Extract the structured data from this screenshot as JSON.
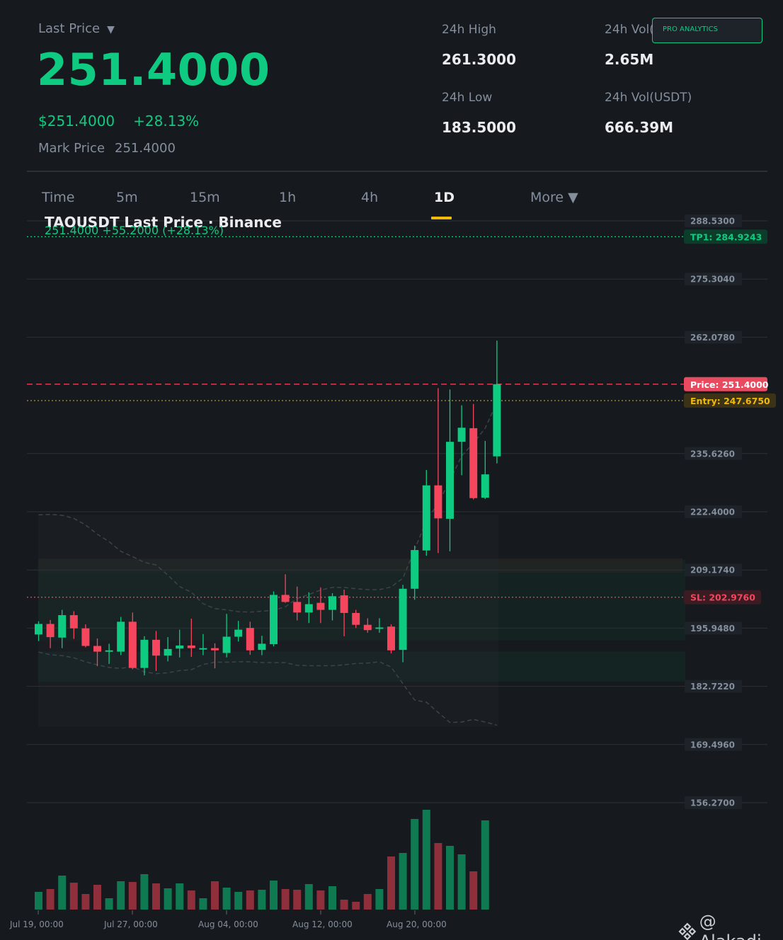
{
  "header": {
    "last_price_label": "Last Price",
    "last_price_caret": "▼",
    "last_price": "251.4000",
    "usd_price": "$251.4000",
    "change_pct": "+28.13%",
    "mark_price_label": "Mark Price",
    "mark_price": "251.4000",
    "stats": [
      {
        "label": "24h High",
        "value": "261.3000"
      },
      {
        "label": "24h Vol(",
        "value": "2.65M"
      },
      {
        "label": "24h Low",
        "value": "183.5000"
      },
      {
        "label": "24h Vol(USDT)",
        "value": "666.39M"
      }
    ],
    "pro_button": "PRO ANALYTICS"
  },
  "tabs": [
    {
      "label": "Time",
      "active": false
    },
    {
      "label": "5m",
      "active": false
    },
    {
      "label": "15m",
      "active": false
    },
    {
      "label": "1h",
      "active": false
    },
    {
      "label": "4h",
      "active": false
    },
    {
      "label": "1D",
      "active": true
    },
    {
      "label": "More ▼",
      "active": false
    }
  ],
  "chart": {
    "title": "TAOUSDT Last Price · Binance",
    "subtitle": "251.4000  +55.2000 (+28.13%)",
    "brand": "@ Alakadi",
    "colors": {
      "up": "#0ecb81",
      "down": "#f6465d",
      "entry": "#f0b90b",
      "bg": "#161a1e",
      "grid": "#2b3139"
    }
  },
  "chart_data": {
    "type": "candlestick",
    "title": "TAOUSDT Last Price · Binance",
    "y_ticks": [
      "288.5300",
      "275.3040",
      "262.0780",
      "235.6260",
      "222.4000",
      "209.1740",
      "195.9480",
      "182.7220",
      "169.4960",
      "156.2700"
    ],
    "ylim": [
      156.27,
      288.53
    ],
    "x_ticks": [
      "Jul 19, 00:00",
      "Jul 27, 00:00",
      "Aug 04, 00:00",
      "Aug 12, 00:00",
      "Aug 20, 00:00"
    ],
    "levels": [
      {
        "label": "TP1: 284.9243",
        "value": 284.9243,
        "kind": "tp"
      },
      {
        "label": "Price: 251.4000",
        "value": 251.4,
        "kind": "price"
      },
      {
        "label": "Entry: 247.6750",
        "value": 247.675,
        "kind": "entry"
      },
      {
        "label": "SL: 202.9760",
        "value": 202.976,
        "kind": "sl"
      }
    ],
    "candles": [
      {
        "o": 194.5,
        "h": 197.5,
        "l": 193.0,
        "c": 196.9
      },
      {
        "o": 196.9,
        "h": 197.8,
        "l": 191.4,
        "c": 193.9
      },
      {
        "o": 193.8,
        "h": 200.1,
        "l": 191.4,
        "c": 198.9
      },
      {
        "o": 198.9,
        "h": 199.8,
        "l": 193.5,
        "c": 195.9
      },
      {
        "o": 195.9,
        "h": 196.8,
        "l": 191.6,
        "c": 191.9
      },
      {
        "o": 191.9,
        "h": 193.6,
        "l": 187.3,
        "c": 190.6
      },
      {
        "o": 190.6,
        "h": 192.4,
        "l": 187.8,
        "c": 190.9
      },
      {
        "o": 190.6,
        "h": 198.5,
        "l": 189.8,
        "c": 197.4
      },
      {
        "o": 197.4,
        "h": 199.5,
        "l": 186.6,
        "c": 186.9
      },
      {
        "o": 186.9,
        "h": 194.1,
        "l": 185.2,
        "c": 193.3
      },
      {
        "o": 193.3,
        "h": 195.3,
        "l": 186.2,
        "c": 189.7
      },
      {
        "o": 189.7,
        "h": 193.9,
        "l": 188.4,
        "c": 191.2
      },
      {
        "o": 191.3,
        "h": 195.6,
        "l": 189.3,
        "c": 192.0
      },
      {
        "o": 192.0,
        "h": 198.1,
        "l": 189.4,
        "c": 191.4
      },
      {
        "o": 191.3,
        "h": 194.6,
        "l": 189.8,
        "c": 191.4
      },
      {
        "o": 191.4,
        "h": 192.5,
        "l": 186.8,
        "c": 190.9
      },
      {
        "o": 190.3,
        "h": 199.2,
        "l": 189.3,
        "c": 194.0
      },
      {
        "o": 194.0,
        "h": 197.6,
        "l": 192.9,
        "c": 195.6
      },
      {
        "o": 196.0,
        "h": 197.4,
        "l": 189.9,
        "c": 190.9
      },
      {
        "o": 191.0,
        "h": 194.2,
        "l": 189.8,
        "c": 192.4
      },
      {
        "o": 192.3,
        "h": 204.3,
        "l": 191.8,
        "c": 203.5
      },
      {
        "o": 203.5,
        "h": 208.2,
        "l": 201.7,
        "c": 201.9
      },
      {
        "o": 201.9,
        "h": 205.4,
        "l": 197.7,
        "c": 199.5
      },
      {
        "o": 199.5,
        "h": 204.1,
        "l": 197.1,
        "c": 201.4
      },
      {
        "o": 201.7,
        "h": 205.2,
        "l": 197.1,
        "c": 200.1
      },
      {
        "o": 200.1,
        "h": 203.9,
        "l": 197.7,
        "c": 203.2
      },
      {
        "o": 203.4,
        "h": 204.7,
        "l": 194.1,
        "c": 199.4
      },
      {
        "o": 199.4,
        "h": 200.1,
        "l": 196.0,
        "c": 196.7
      },
      {
        "o": 196.7,
        "h": 198.2,
        "l": 194.9,
        "c": 195.5
      },
      {
        "o": 195.8,
        "h": 198.2,
        "l": 194.9,
        "c": 196.1
      },
      {
        "o": 196.3,
        "h": 196.8,
        "l": 190.2,
        "c": 190.9
      },
      {
        "o": 191.0,
        "h": 205.8,
        "l": 188.2,
        "c": 204.9
      },
      {
        "o": 204.9,
        "h": 214.7,
        "l": 202.4,
        "c": 213.7
      },
      {
        "o": 213.6,
        "h": 231.9,
        "l": 212.4,
        "c": 228.4
      },
      {
        "o": 228.4,
        "h": 250.5,
        "l": 213.0,
        "c": 220.9
      },
      {
        "o": 220.8,
        "h": 250.2,
        "l": 213.4,
        "c": 238.3
      },
      {
        "o": 238.3,
        "h": 246.6,
        "l": 230.7,
        "c": 241.5
      },
      {
        "o": 241.4,
        "h": 246.9,
        "l": 225.2,
        "c": 225.5
      },
      {
        "o": 225.6,
        "h": 238.5,
        "l": 225.3,
        "c": 230.9
      },
      {
        "o": 235.0,
        "h": 261.3,
        "l": 233.4,
        "c": 251.4
      }
    ],
    "volumes": [
      25,
      29,
      48,
      38,
      22,
      35,
      16,
      40,
      39,
      50,
      37,
      30,
      37,
      27,
      16,
      40,
      31,
      25,
      27,
      28,
      41,
      29,
      28,
      36,
      27,
      33,
      14,
      11,
      22,
      29,
      75,
      80,
      128,
      141,
      94,
      90,
      78,
      54,
      126
    ],
    "bollinger": {
      "upper": [
        221.7,
        221.8,
        221.6,
        220.9,
        219.4,
        217.3,
        215.6,
        213.4,
        212.2,
        210.9,
        210.3,
        208.0,
        205.4,
        204.1,
        201.5,
        200.4,
        200.1,
        199.7,
        199.6,
        199.8,
        200.0,
        200.8,
        202.7,
        203.6,
        204.6,
        205.2,
        205.2,
        204.9,
        204.7,
        204.7,
        205.3,
        207.3,
        213.8,
        220.4,
        224.3,
        229.5,
        235.1,
        238.0,
        241.4,
        247.2
      ],
      "lower": [
        190.5,
        189.9,
        189.7,
        189.2,
        188.3,
        187.6,
        187.0,
        186.8,
        187.2,
        186.0,
        185.6,
        185.8,
        186.3,
        186.5,
        187.7,
        188.2,
        188.2,
        188.3,
        188.3,
        188.1,
        188.1,
        188.1,
        187.5,
        187.4,
        187.4,
        187.4,
        187.6,
        187.9,
        188.0,
        188.3,
        187.1,
        183.3,
        179.6,
        179.1,
        176.8,
        174.5,
        174.6,
        175.2,
        174.6,
        173.9
      ]
    }
  }
}
